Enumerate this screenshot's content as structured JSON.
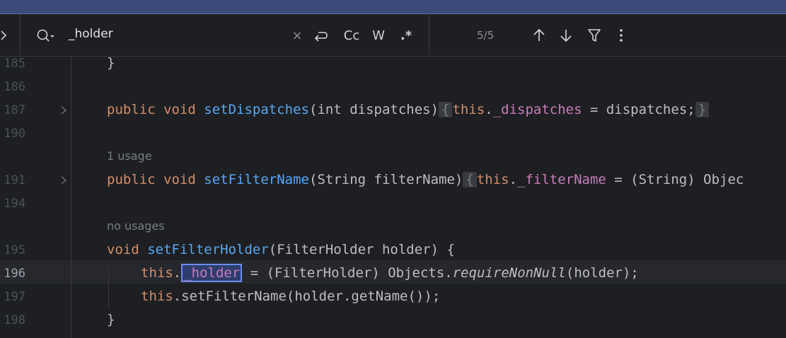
{
  "find_bar": {
    "query": "_holder",
    "clear_label": "×",
    "match_case_label": "Cc",
    "words_label": "W",
    "regex_label": ".*",
    "match_count": "5/5"
  },
  "editor": {
    "hint_1": "1 usage",
    "hint_2": "no usages",
    "lines": [
      {
        "number": "185"
      },
      {
        "number": "186"
      },
      {
        "number": "187"
      },
      {
        "number": "190"
      },
      {
        "number": "191"
      },
      {
        "number": "194"
      },
      {
        "number": "195"
      },
      {
        "number": "196"
      },
      {
        "number": "197"
      },
      {
        "number": "198"
      }
    ],
    "code": {
      "l185": "}",
      "l187_kw": "public void ",
      "l187_fn": "setDispatches",
      "l187_params": "(int dispatches)",
      "l187_brace_open": "{",
      "l187_this": "this",
      "l187_dot": ".",
      "l187_field": "_dispatches",
      "l187_rest": " = dispatches;",
      "l187_brace_close": "}",
      "l191_kw": "public void ",
      "l191_fn": "setFilterName",
      "l191_params": "(String filterName)",
      "l191_brace_open": "{",
      "l191_this": "this",
      "l191_dot": ".",
      "l191_field": "_filterName",
      "l191_rest": " = (String) Objec",
      "l195_kw": "void ",
      "l195_fn": "setFilterHolder",
      "l195_rest": "(FilterHolder holder) {",
      "l196_this": "this",
      "l196_dot": ".",
      "l196_field": "_holder",
      "l196_mid": " = (FilterHolder) Objects.",
      "l196_method": "requireNonNull",
      "l196_end": "(holder);",
      "l197_this": "this",
      "l197_rest": ".setFilterName(holder.getName());",
      "l198": "}"
    }
  }
}
